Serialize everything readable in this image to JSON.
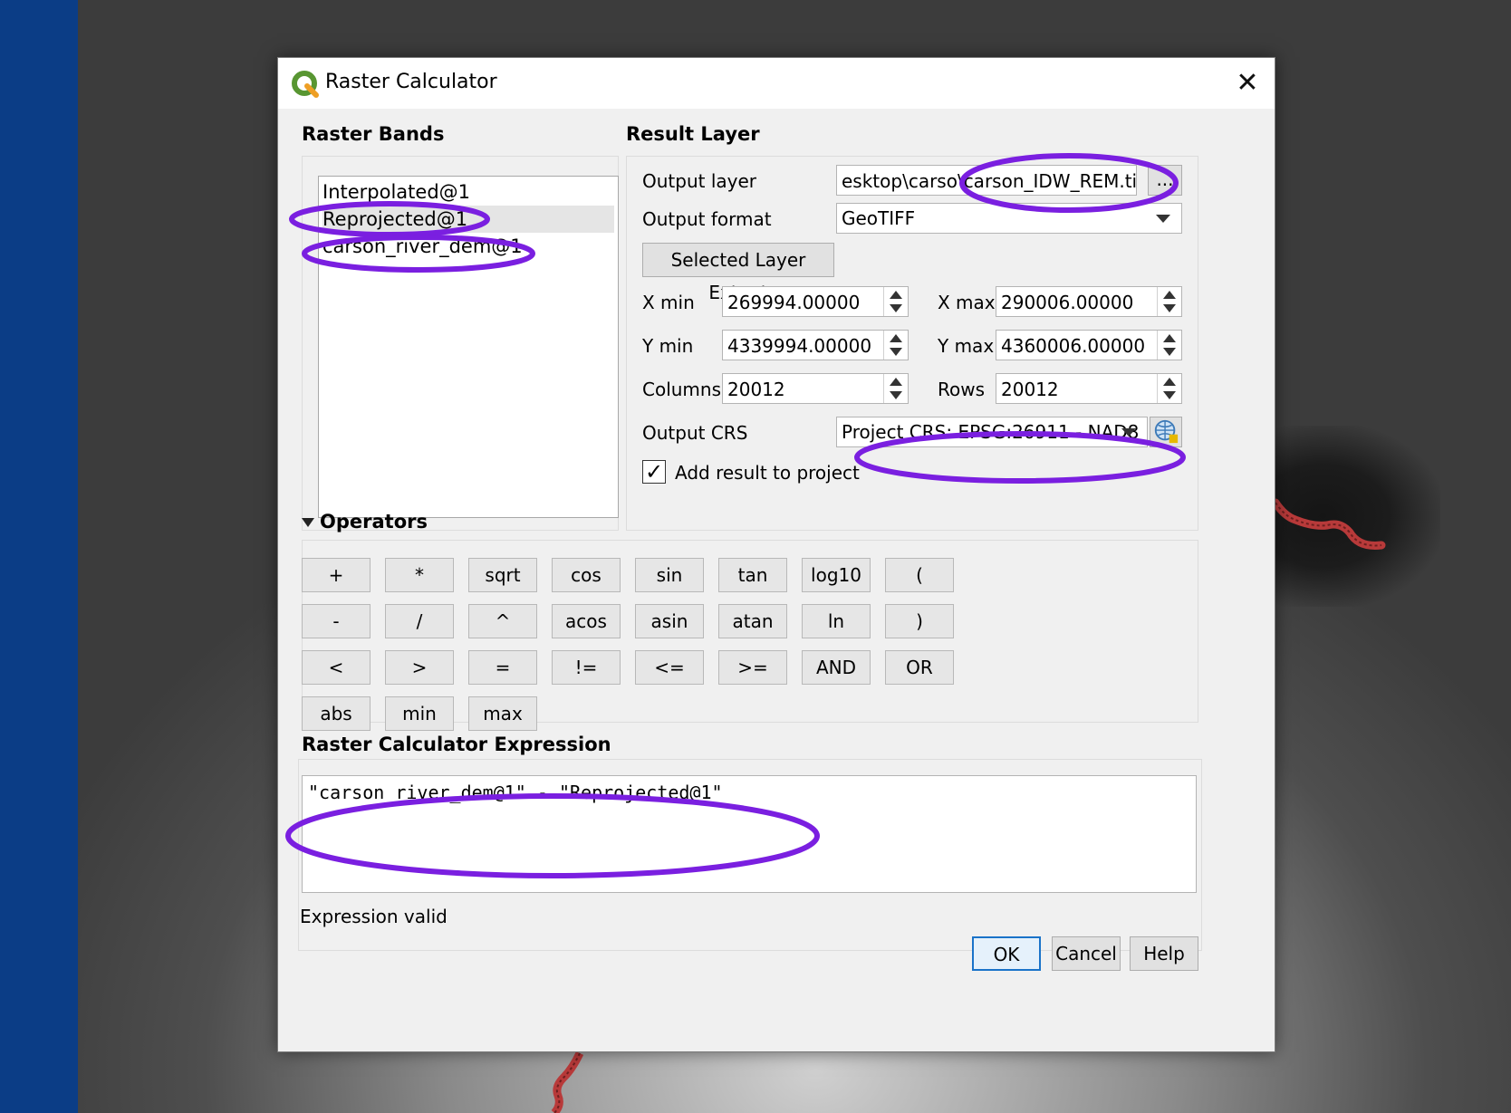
{
  "window": {
    "title": "Raster Calculator"
  },
  "raster_bands": {
    "heading": "Raster Bands",
    "items": [
      "Interpolated@1",
      "Reprojected@1",
      "carson_river_dem@1"
    ]
  },
  "result_layer": {
    "heading": "Result Layer",
    "output_layer_label": "Output layer",
    "output_layer_value": "esktop\\carso\\carson_IDW_REM.tif",
    "browse_label": "...",
    "output_format_label": "Output format",
    "output_format_value": "GeoTIFF",
    "extent_button": "Selected Layer Extent",
    "xmin_label": "X min",
    "xmin_value": "269994.00000",
    "xmax_label": "X max",
    "xmax_value": "290006.00000",
    "ymin_label": "Y min",
    "ymin_value": "4339994.00000",
    "ymax_label": "Y max",
    "ymax_value": "4360006.00000",
    "columns_label": "Columns",
    "columns_value": "20012",
    "rows_label": "Rows",
    "rows_value": "20012",
    "crs_label": "Output CRS",
    "crs_value": "Project CRS: EPSG:26911 - NAD8",
    "add_result_label": "Add result to project",
    "add_result_checked": true
  },
  "operators": {
    "heading": "Operators",
    "buttons": [
      [
        "+",
        "*",
        "sqrt",
        "cos",
        "sin",
        "tan",
        "log10",
        "("
      ],
      [
        "-",
        "/",
        "^",
        "acos",
        "asin",
        "atan",
        "ln",
        ")"
      ],
      [
        "<",
        ">",
        "=",
        "!=",
        "<=",
        ">=",
        "AND",
        "OR"
      ],
      [
        "abs",
        "min",
        "max"
      ]
    ]
  },
  "expression": {
    "heading": "Raster Calculator Expression",
    "value": "\"carson_river_dem@1\" - \"Reprojected@1\"",
    "status": "Expression valid"
  },
  "buttons": {
    "ok": "OK",
    "cancel": "Cancel",
    "help": "Help"
  },
  "colors": {
    "annotation": "#7a1fe0",
    "background_strip": "#0b3d86",
    "river": "#b83a3a"
  }
}
